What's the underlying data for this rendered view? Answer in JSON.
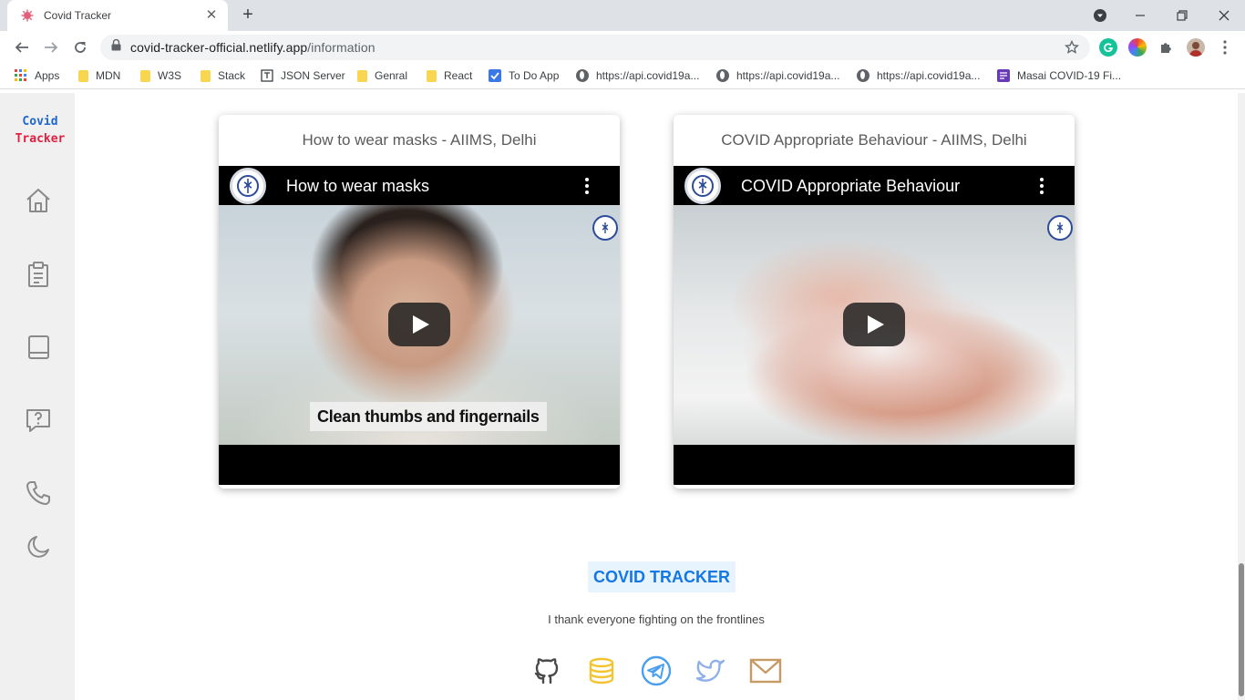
{
  "browser": {
    "tab_title": "Covid Tracker",
    "tab_close": "✕",
    "new_tab": "+",
    "url_host": "covid-tracker-official.netlify.app",
    "url_path": "/information"
  },
  "bookmarks": [
    {
      "label": "Apps",
      "icon": "apps-grid-icon"
    },
    {
      "label": "MDN",
      "icon": "folder-icon"
    },
    {
      "label": "W3S",
      "icon": "folder-icon"
    },
    {
      "label": "Stack",
      "icon": "folder-icon"
    },
    {
      "label": "JSON Server",
      "icon": "json-server-icon"
    },
    {
      "label": "Genral",
      "icon": "folder-icon"
    },
    {
      "label": "React",
      "icon": "folder-icon"
    },
    {
      "label": "To Do App",
      "icon": "checkbox-icon"
    },
    {
      "label": "https://api.covid19a...",
      "icon": "globe-icon"
    },
    {
      "label": "https://api.covid19a...",
      "icon": "globe-icon"
    },
    {
      "label": "https://api.covid19a...",
      "icon": "globe-icon"
    },
    {
      "label": "Masai COVID-19 Fi...",
      "icon": "form-icon"
    }
  ],
  "app": {
    "logo_line1": "Covid",
    "logo_line2": "Tracker",
    "colors": {
      "logo_blue": "#1e66d0",
      "logo_red": "#e41e3f",
      "brand_blue": "#1477e6"
    },
    "sidebar": [
      "home-icon",
      "clipboard-icon",
      "book-icon",
      "help-icon",
      "phone-icon",
      "moon-icon"
    ]
  },
  "cards": [
    {
      "title": "How to wear masks - AIIMS, Delhi",
      "video_title": "How to wear masks",
      "caption": "Clean thumbs and fingernails"
    },
    {
      "title": "COVID Appropriate Behaviour - AIIMS, Delhi",
      "video_title": "COVID Appropriate Behaviour"
    }
  ],
  "footer": {
    "brand": "COVID TRACKER",
    "message": "I thank everyone fighting on the frontlines",
    "social": [
      "github-icon",
      "database-icon",
      "telegram-icon",
      "twitter-icon",
      "mail-icon"
    ]
  }
}
